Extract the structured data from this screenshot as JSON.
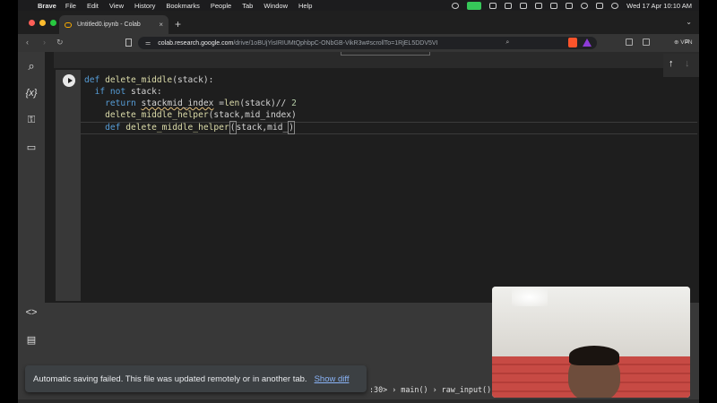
{
  "menubar": {
    "app_name": "Brave",
    "items": [
      "File",
      "Edit",
      "View",
      "History",
      "Bookmarks",
      "People",
      "Tab",
      "Window",
      "Help"
    ],
    "datetime": "Wed 17 Apr  10:10 AM"
  },
  "browser": {
    "tab_title": "Untitled0.ipynb - Colab",
    "tab_close": "×",
    "new_tab": "+",
    "tab_menu": "⌄",
    "url_domain": "colab.research.google.com",
    "url_path": "/drive/1oBUjYisIRIUMtQphbpC-ONbGB-VikR3w#scrollTo=1RjEL5DDV5VI",
    "vpn_label": "⊕ VPN"
  },
  "sidebar": {
    "search": "⌕",
    "variables": "{x}",
    "secrets": "⚿",
    "files": "▭",
    "code_snippets": "<>",
    "command_palette": "▤"
  },
  "code": {
    "line1_kw": "def",
    "line1_fn": "delete_middle",
    "line1_rest": "(stack):",
    "line2_kw1": "if",
    "line2_kw2": "not",
    "line2_rest": " stack:",
    "line3_kw": "return",
    "line3_squiggle": "stackmid_index",
    "line3_mid": " =",
    "line3_fn": "len",
    "line3_rest": "(stack)// ",
    "line3_num": "2",
    "line4_fn": "delete_middle_helper",
    "line4_rest": "(stack,mid_index)",
    "line5_kw": "def",
    "line5_fn": "delete_middle_helper",
    "line5_bracket": "(",
    "line5_rest": "stack,mid_",
    "line5_close": ")"
  },
  "cell_toolbar": {
    "up": "↑",
    "down": "↓"
  },
  "toast": {
    "message": "Automatic saving failed. This file was updated remotely or in another tab.",
    "action": "Show diff"
  },
  "traceback": ":30> › main() › raw_input() › _inpu"
}
